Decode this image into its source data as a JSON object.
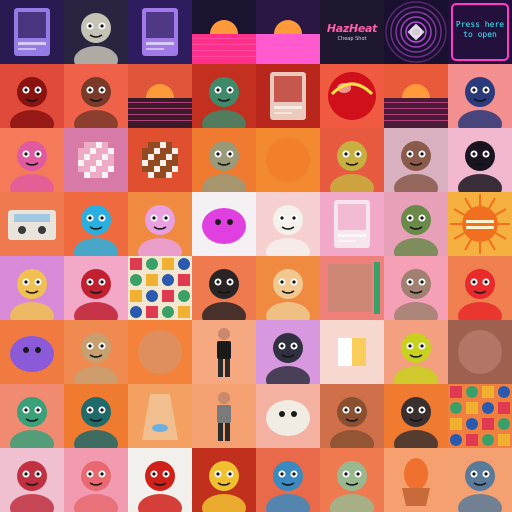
{
  "gallery": {
    "tiles": [
      {
        "name": "purple-trading-card",
        "icon": "card-icon",
        "bg": "#2a1a52",
        "fg": "#a98cff",
        "motif": "card"
      },
      {
        "name": "zombie-skeleton-avatar",
        "icon": "skeleton-icon",
        "bg": "#2b2440",
        "fg": "#c7c2b6",
        "motif": "char"
      },
      {
        "name": "violet-glow-card",
        "icon": "card-icon",
        "bg": "#2d1c5e",
        "fg": "#b58cff",
        "motif": "card"
      },
      {
        "name": "synthwave-car-scene",
        "icon": "car-icon",
        "bg": "#1b1430",
        "fg": "#ff2f8a",
        "motif": "sunset"
      },
      {
        "name": "synthwave-road-scene",
        "icon": "road-icon",
        "bg": "#2a1744",
        "fg": "#ff5ad6",
        "motif": "sunset"
      },
      {
        "name": "hazheat-logo",
        "icon": "logo-icon",
        "bg": "#1f1630",
        "fg": "#ff5ea8",
        "motif": "logo",
        "title": "HazHeat",
        "subtitle": "Cheap Shot"
      },
      {
        "name": "vortex-tunnel",
        "icon": "vortex-icon",
        "bg": "#1a1030",
        "fg": "#e05aff",
        "motif": "vortex"
      },
      {
        "name": "press-here-neon-sign",
        "icon": "neon-sign-icon",
        "bg": "#24103d",
        "fg": "#ff3cc8",
        "motif": "neon",
        "line1": "Press here",
        "line2": "to open"
      },
      {
        "name": "red-hat-figure",
        "icon": "figure-icon",
        "bg": "#e04a3a",
        "fg": "#8a1210",
        "motif": "char"
      },
      {
        "name": "otter-cap-avatar",
        "icon": "otter-icon",
        "bg": "#f0614a",
        "fg": "#7a3a2a",
        "motif": "char"
      },
      {
        "name": "palm-sunset",
        "icon": "palm-icon",
        "bg": "#e0563a",
        "fg": "#3b1a2a",
        "motif": "sunset"
      },
      {
        "name": "robot-mech-avatar",
        "icon": "robot-icon",
        "bg": "#c43020",
        "fg": "#3f8a6a",
        "motif": "char"
      },
      {
        "name": "poster-collage",
        "icon": "poster-icon",
        "bg": "#b8261c",
        "fg": "#f3e6d8",
        "motif": "card"
      },
      {
        "name": "red-sphere",
        "icon": "sphere-icon",
        "bg": "#f05a40",
        "fg": "#d0101a",
        "motif": "orb"
      },
      {
        "name": "ocean-sunset",
        "icon": "sun-icon",
        "bg": "#e85a3a",
        "fg": "#4a1c3a",
        "motif": "sunset"
      },
      {
        "name": "pink-demon-avatar",
        "icon": "demon-icon",
        "bg": "#f38f8f",
        "fg": "#2a3a7a",
        "motif": "char"
      },
      {
        "name": "sunglasses-portrait",
        "icon": "portrait-icon",
        "bg": "#f47a5a",
        "fg": "#e05aa0",
        "motif": "char"
      },
      {
        "name": "pixel-pig-face",
        "icon": "pixel-icon",
        "bg": "#d87aa8",
        "fg": "#f0b0c8",
        "motif": "pixel"
      },
      {
        "name": "pixel-cookie",
        "icon": "pixel-icon",
        "bg": "#e05030",
        "fg": "#8a4a20",
        "motif": "pixel"
      },
      {
        "name": "zombie-bust",
        "icon": "zombie-icon",
        "bg": "#f07a30",
        "fg": "#9a9a78",
        "motif": "char"
      },
      {
        "name": "orange-gradient",
        "icon": "gradient-icon",
        "bg": "#f38a30",
        "fg": "#f06a20",
        "motif": "plain"
      },
      {
        "name": "horned-bull",
        "icon": "bull-icon",
        "bg": "#e85a40",
        "fg": "#c8b040",
        "motif": "char"
      },
      {
        "name": "robot-cow",
        "icon": "cow-icon",
        "bg": "#d8b0c0",
        "fg": "#8a5a4a",
        "motif": "char"
      },
      {
        "name": "black-rooster",
        "icon": "rooster-icon",
        "bg": "#f2b8d0",
        "fg": "#1a1420",
        "motif": "char"
      },
      {
        "name": "cassette-tape",
        "icon": "cassette-icon",
        "bg": "#f07a50",
        "fg": "#e8e4dc",
        "motif": "cassette"
      },
      {
        "name": "spray-bottle-figure",
        "icon": "bottle-icon",
        "bg": "#f06a40",
        "fg": "#2ab0e0",
        "motif": "char"
      },
      {
        "name": "cartoon-cat-mask",
        "icon": "cat-icon",
        "bg": "#f08a40",
        "fg": "#e8a0e0",
        "motif": "char"
      },
      {
        "name": "pink-scribble-monster",
        "icon": "monster-icon",
        "bg": "#f4f0f4",
        "fg": "#e040e0",
        "motif": "blob"
      },
      {
        "name": "white-unicorn",
        "icon": "unicorn-icon",
        "bg": "#f6d0d0",
        "fg": "#f4f0ec",
        "motif": "char"
      },
      {
        "name": "profile-card",
        "icon": "card-icon",
        "bg": "#f2a8c8",
        "fg": "#f6f0f4",
        "motif": "card"
      },
      {
        "name": "frog-face",
        "icon": "frog-icon",
        "bg": "#e8a0b8",
        "fg": "#6a8a4a",
        "motif": "char"
      },
      {
        "name": "retro-sun-badge",
        "icon": "sun-icon",
        "bg": "#f6b040",
        "fg": "#f07020",
        "motif": "sunbadge"
      },
      {
        "name": "doodle-creature",
        "icon": "doodle-icon",
        "bg": "#d88ad8",
        "fg": "#f0c050",
        "motif": "char"
      },
      {
        "name": "elf-stage-character",
        "icon": "elf-icon",
        "bg": "#f4a8c8",
        "fg": "#c02030",
        "motif": "char"
      },
      {
        "name": "geometric-pattern",
        "icon": "pattern-icon",
        "bg": "#f3e6d0",
        "fg": "#e03a50",
        "motif": "pattern"
      },
      {
        "name": "chef-bear",
        "icon": "bear-icon",
        "bg": "#f07a50",
        "fg": "#2a2424",
        "motif": "char"
      },
      {
        "name": "shiba-dog",
        "icon": "dog-icon",
        "bg": "#f08a40",
        "fg": "#f0c890",
        "motif": "char"
      },
      {
        "name": "salmon-panel",
        "icon": "panel-icon",
        "bg": "#f0807a",
        "fg": "#3aa06a",
        "motif": "panel"
      },
      {
        "name": "pirate-mouse",
        "icon": "mouse-icon",
        "bg": "#f6a0b8",
        "fg": "#a08070",
        "motif": "char"
      },
      {
        "name": "space-robot",
        "icon": "robot-icon",
        "bg": "#f08050",
        "fg": "#e82a2a",
        "motif": "char"
      },
      {
        "name": "purple-blob",
        "icon": "blob-icon",
        "bg": "#f07a40",
        "fg": "#8a5ad8",
        "motif": "blob"
      },
      {
        "name": "chef-swirl-face",
        "icon": "chef-icon",
        "bg": "#f08a50",
        "fg": "#c8a070",
        "motif": "char"
      },
      {
        "name": "blurred-gradient",
        "icon": "gradient-icon",
        "bg": "#f4823a",
        "fg": "#b8a8a0",
        "motif": "plain"
      },
      {
        "name": "standing-person",
        "icon": "person-icon",
        "bg": "#f6a880",
        "fg": "#1a1a1a",
        "motif": "person"
      },
      {
        "name": "masked-cat-portrait",
        "icon": "cat-icon",
        "bg": "#d898e0",
        "fg": "#303040",
        "motif": "char"
      },
      {
        "name": "white-square-glow",
        "icon": "square-icon",
        "bg": "#f6d8d0",
        "fg": "#f6c030",
        "motif": "square"
      },
      {
        "name": "green-vest-mouse",
        "icon": "mouse-icon",
        "bg": "#f4a080",
        "fg": "#c8d020",
        "motif": "char"
      },
      {
        "name": "rust-texture",
        "icon": "texture-icon",
        "bg": "#a06050",
        "fg": "#d0a090",
        "motif": "plain"
      },
      {
        "name": "green-hair-girl",
        "icon": "girl-icon",
        "bg": "#f08a70",
        "fg": "#3aa07a",
        "motif": "char"
      },
      {
        "name": "teal-bird-character",
        "icon": "bird-icon",
        "bg": "#f07a30",
        "fg": "#206a6a",
        "motif": "char"
      },
      {
        "name": "plastic-bag-fish",
        "icon": "bag-icon",
        "bg": "#f4a060",
        "fg": "#f0c8a0",
        "motif": "bag"
      },
      {
        "name": "gray-shirt-person",
        "icon": "person-icon",
        "bg": "#f4a070",
        "fg": "#7a7a7a",
        "motif": "person"
      },
      {
        "name": "white-creature-lying",
        "icon": "creature-icon",
        "bg": "#f4b0a0",
        "fg": "#f0ece4",
        "motif": "blob"
      },
      {
        "name": "bobcat-photo",
        "icon": "cat-icon",
        "bg": "#d0704a",
        "fg": "#8a5030",
        "motif": "char"
      },
      {
        "name": "crossed-tools-emblem",
        "icon": "tools-icon",
        "bg": "#f07a30",
        "fg": "#3a3030",
        "motif": "char"
      },
      {
        "name": "pizza-pattern",
        "icon": "pizza-icon",
        "bg": "#f08040",
        "fg": "#e84a20",
        "motif": "pattern"
      },
      {
        "name": "graffiti-face",
        "icon": "graffiti-icon",
        "bg": "#f0c0d0",
        "fg": "#c03040",
        "motif": "char"
      },
      {
        "name": "pink-monster-mask",
        "icon": "monster-icon",
        "bg": "#f29ab0",
        "fg": "#e86a70",
        "motif": "char"
      },
      {
        "name": "red-opera-mask",
        "icon": "mask-icon",
        "bg": "#f2f0ec",
        "fg": "#d0201a",
        "motif": "char"
      },
      {
        "name": "yellow-cat-figure",
        "icon": "cat-icon",
        "bg": "#c0301c",
        "fg": "#f0c030",
        "motif": "char"
      },
      {
        "name": "hooded-grandma",
        "icon": "hood-icon",
        "bg": "#e86a4a",
        "fg": "#3a8ac0",
        "motif": "char"
      },
      {
        "name": "green-beanie-zombie",
        "icon": "zombie-icon",
        "bg": "#f07a50",
        "fg": "#9ab890",
        "motif": "char"
      },
      {
        "name": "potted-egg",
        "icon": "egg-icon",
        "bg": "#f6a070",
        "fg": "#f07030",
        "motif": "egg"
      },
      {
        "name": "blue-robot-figure",
        "icon": "robot-icon",
        "bg": "#f4a070",
        "fg": "#5a7a9a",
        "motif": "char"
      }
    ]
  }
}
